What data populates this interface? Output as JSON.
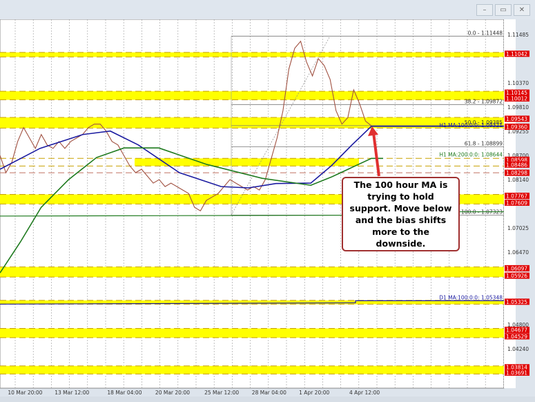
{
  "window": {
    "buttons": [
      {
        "name": "minimize",
        "glyph": "–"
      },
      {
        "name": "restore",
        "glyph": "▭"
      },
      {
        "name": "close",
        "glyph": "✕"
      }
    ]
  },
  "annotation": {
    "text": "The 100 hour MA is trying to hold support. Move below and the bias shifts more to the downside."
  },
  "chart_data": {
    "type": "line",
    "title": "",
    "ylim": [
      1.034,
      1.119
    ],
    "y_ticks": [
      "1.11485",
      "1.10370",
      "1.09810",
      "1.09255",
      "1.08700",
      "1.08140",
      "1.07025",
      "1.06470",
      "1.04800",
      "1.04240"
    ],
    "x_ticks": [
      {
        "label": "10 Mar 20:00",
        "bar": 4.4
      },
      {
        "label": "13 Mar 12:00",
        "bar": 12.6
      },
      {
        "label": "18 Mar 04:00",
        "bar": 21.8
      },
      {
        "label": "20 Mar 20:00",
        "bar": 30.2
      },
      {
        "label": "25 Mar 12:00",
        "bar": 38.8
      },
      {
        "label": "28 Mar 04:00",
        "bar": 47.1
      },
      {
        "label": "1 Apr 20:00",
        "bar": 55.0
      },
      {
        "label": "4 Apr 12:00",
        "bar": 63.8
      }
    ],
    "grid": true,
    "price": [
      1.087,
      1.083,
      1.0854,
      1.0902,
      1.0934,
      1.091,
      1.0886,
      1.0918,
      1.0894,
      1.0886,
      1.0902,
      1.0886,
      1.0902,
      1.091,
      1.0918,
      1.0934,
      1.0942,
      1.0942,
      1.0926,
      1.0902,
      1.0894,
      1.087,
      1.0846,
      1.083,
      1.0838,
      1.0822,
      1.0806,
      1.0814,
      1.0798,
      1.0806,
      1.0798,
      1.079,
      1.0782,
      1.075,
      1.0742,
      1.0766,
      1.0774,
      1.0782,
      1.0798,
      1.0814,
      1.0806,
      1.0798,
      1.079,
      1.0798,
      1.079,
      1.0814,
      1.0862,
      1.091,
      1.0973,
      1.1069,
      1.1117,
      1.1133,
      1.1085,
      1.1053,
      1.1093,
      1.1077,
      1.1045,
      1.0973,
      1.0942,
      1.0957,
      1.1021,
      1.0989,
      1.0949,
      1.0938
    ],
    "series": [
      {
        "name": "H1 MA:100",
        "color": "#1a1aa0",
        "points": [
          [
            0,
            1.0838
          ],
          [
            7,
            1.0886
          ],
          [
            14.5,
            1.0918
          ],
          [
            19.3,
            1.0926
          ],
          [
            24.2,
            1.0894
          ],
          [
            31.4,
            1.083
          ],
          [
            38.7,
            1.0798
          ],
          [
            43.5,
            1.0795
          ],
          [
            48.3,
            1.0805
          ],
          [
            54.4,
            1.0806
          ],
          [
            58,
            1.0846
          ],
          [
            61.6,
            1.0894
          ],
          [
            65,
            1.0937
          ]
        ]
      },
      {
        "name": "H1 MA:200",
        "color": "#1e7a1e",
        "points": [
          [
            0,
            1.0599
          ],
          [
            3.6,
            1.0671
          ],
          [
            7.2,
            1.075
          ],
          [
            12,
            1.0814
          ],
          [
            16.9,
            1.0865
          ],
          [
            21.7,
            1.0887
          ],
          [
            27.8,
            1.0887
          ],
          [
            36.2,
            1.0849
          ],
          [
            45.9,
            1.0817
          ],
          [
            54.4,
            1.0801
          ],
          [
            58,
            1.082
          ],
          [
            65,
            1.0863
          ]
        ]
      }
    ],
    "line_labels": [
      {
        "text": "H1 MA:100:0:0: 1.09321",
        "price": 1.09321,
        "color": "#1a1aa0"
      },
      {
        "text": "H1 MA:200:0:0: 1.08644",
        "price": 1.08644,
        "color": "#1e7a1e"
      },
      {
        "text": "D1 MA:100:0:0: 1.05348",
        "price": 1.05348,
        "color": "#1a1aa0"
      }
    ],
    "fib": [
      {
        "text": "0.0 - 1.11448",
        "price": 1.11448
      },
      {
        "text": "38.2 - 1.09872",
        "price": 1.09872
      },
      {
        "text": "50.0 - 1.09385",
        "price": 1.09385
      },
      {
        "text": "61.8 - 1.08899",
        "price": 1.08899
      },
      {
        "text": "100.0 - 1.07323",
        "price": 1.07323
      }
    ],
    "bands": [
      {
        "top": 1.11042,
        "bottom": 1.11
      },
      {
        "top": 1.10145,
        "bottom": 1.10012
      },
      {
        "top": 1.09543,
        "bottom": 1.0936
      },
      {
        "top": 1.08598,
        "bottom": 1.08486,
        "partial": true
      },
      {
        "top": 1.07767,
        "bottom": 1.07609
      },
      {
        "top": 1.06097,
        "bottom": 1.05926
      },
      {
        "top": 1.05325,
        "bottom": 1.053
      },
      {
        "top": 1.04677,
        "bottom": 1.04529
      },
      {
        "top": 1.03814,
        "bottom": 1.03691
      }
    ],
    "dashed_levels": [
      1.08298
    ],
    "price_labels": [
      "1.11042",
      "1.10145",
      "1.10012",
      "1.09543",
      "1.09360",
      "1.08598",
      "1.08486",
      "1.08298",
      "1.07767",
      "1.07609",
      "1.06097",
      "1.05926",
      "1.05325",
      "1.04677",
      "1.04529",
      "1.03814",
      "1.03691"
    ],
    "colors": {
      "band": "#ffff00",
      "band_edge": "#c8a000",
      "label_bg": "#e00000",
      "price_line": "#a05040",
      "annotation_border": "#a03030"
    }
  }
}
